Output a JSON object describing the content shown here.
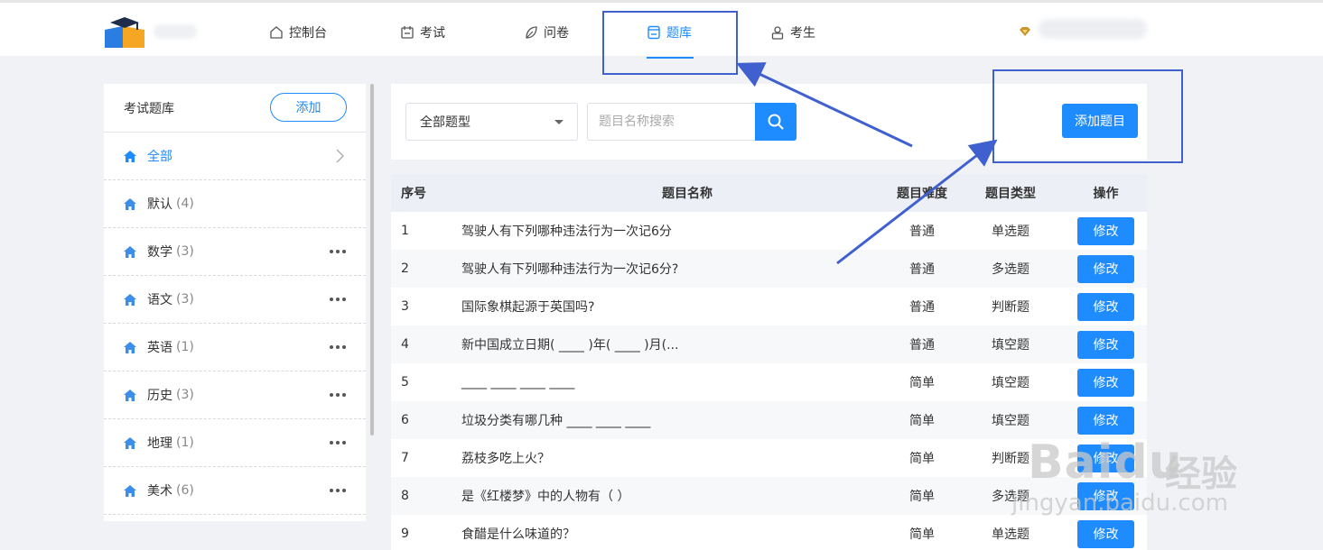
{
  "header": {
    "nav": [
      {
        "label": "控制台",
        "icon": "home-outline-icon"
      },
      {
        "label": "考试",
        "icon": "calendar-icon"
      },
      {
        "label": "问卷",
        "icon": "leaf-icon"
      },
      {
        "label": "题库",
        "icon": "question-bank-icon",
        "active": true
      },
      {
        "label": "考生",
        "icon": "person-icon"
      }
    ]
  },
  "sidebar": {
    "title": "考试题库",
    "add_label": "添加",
    "items": [
      {
        "label": "全部",
        "count": ""
      },
      {
        "label": "默认",
        "count": "(4)"
      },
      {
        "label": "数学",
        "count": "(3)"
      },
      {
        "label": "语文",
        "count": "(3)"
      },
      {
        "label": "英语",
        "count": "(1)"
      },
      {
        "label": "历史",
        "count": "(3)"
      },
      {
        "label": "地理",
        "count": "(1)"
      },
      {
        "label": "美术",
        "count": "(6)"
      }
    ]
  },
  "toolbar": {
    "type_select": "全部题型",
    "search_placeholder": "题目名称搜索",
    "add_question_label": "添加题目"
  },
  "table": {
    "headers": {
      "idx": "序号",
      "name": "题目名称",
      "difficulty": "题目难度",
      "type": "题目类型",
      "op": "操作"
    },
    "edit_label": "修改",
    "rows": [
      {
        "idx": "1",
        "name": "驾驶人有下列哪种违法行为一次记6分",
        "difficulty": "普通",
        "type": "单选题"
      },
      {
        "idx": "2",
        "name": "驾驶人有下列哪种违法行为一次记6分?",
        "difficulty": "普通",
        "type": "多选题"
      },
      {
        "idx": "3",
        "name": "国际象棋起源于英国吗?",
        "difficulty": "普通",
        "type": "判断题"
      },
      {
        "idx": "4",
        "name": "新中国成立日期( ____ )年( ____ )月(...",
        "difficulty": "普通",
        "type": "填空题"
      },
      {
        "idx": "5",
        "name": "____ ____ ____ ____",
        "difficulty": "简单",
        "type": "填空题"
      },
      {
        "idx": "6",
        "name": "垃圾分类有哪几种 ____ ____ ____",
        "difficulty": "简单",
        "type": "填空题"
      },
      {
        "idx": "7",
        "name": "荔枝多吃上火？",
        "difficulty": "简单",
        "type": "判断题"
      },
      {
        "idx": "8",
        "name": "是《红楼梦》中的人物有（ ）",
        "difficulty": "简单",
        "type": "多选题"
      },
      {
        "idx": "9",
        "name": "食醋是什么味道的？",
        "difficulty": "简单",
        "type": "单选题"
      }
    ]
  },
  "watermark": {
    "brand": "Baidu",
    "cn": "经验",
    "url": "jingyan.baidu.com"
  },
  "colors": {
    "accent": "#1e8bff",
    "annotation": "#4060d0"
  }
}
